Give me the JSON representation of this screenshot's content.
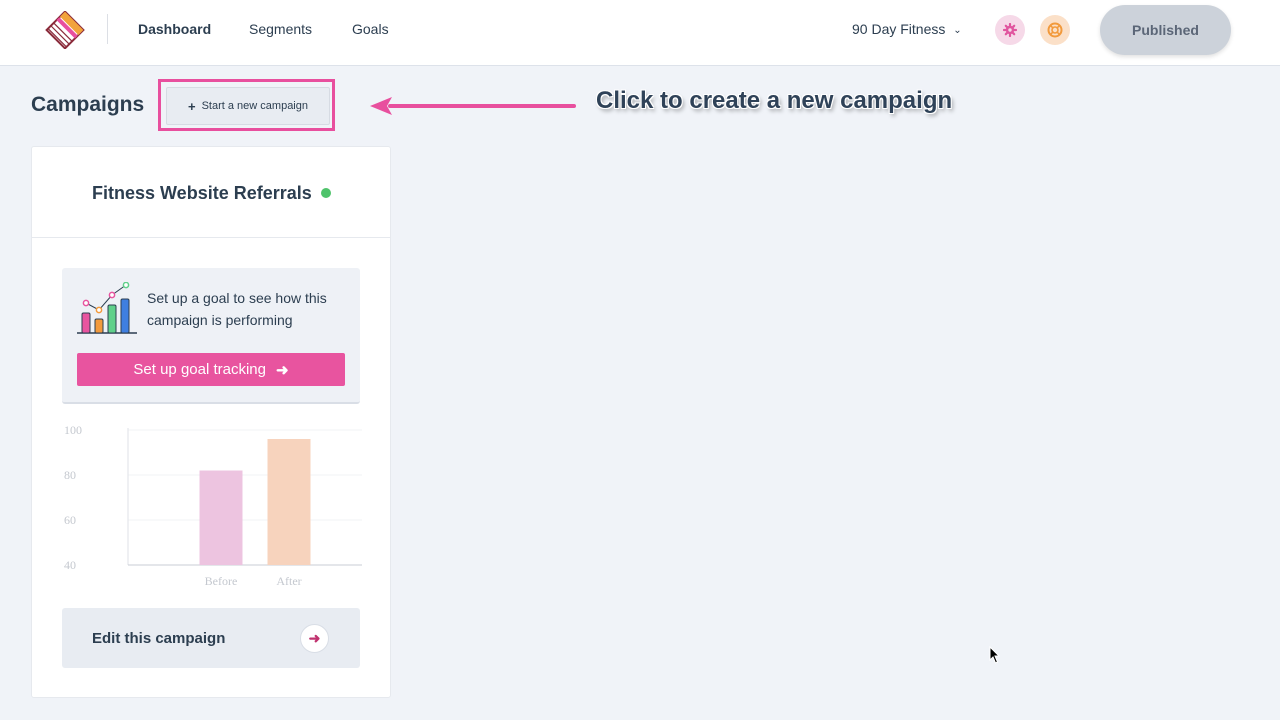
{
  "nav": {
    "dashboard": "Dashboard",
    "segments": "Segments",
    "goals": "Goals",
    "site_name": "90 Day Fitness",
    "publish": "Published",
    "icons": [
      "logo-icon",
      "chevron-down-icon",
      "gear-icon",
      "lifebuoy-icon"
    ]
  },
  "page": {
    "title": "Campaigns",
    "new_campaign_label": "Start a new campaign",
    "callout": "Click to create a new campaign"
  },
  "campaign": {
    "title": "Fitness Website Referrals",
    "status_color": "#4fc36b",
    "goal_prompt": "Set up a goal to see how this campaign is performing",
    "goal_button": "Set up goal tracking",
    "edit_label": "Edit this campaign"
  },
  "colors": {
    "accent": "#e8549f",
    "highlight": "#e84f9e",
    "publish_bg": "#ccd2da"
  },
  "chart_data": {
    "type": "bar",
    "categories": [
      "Before",
      "After"
    ],
    "values": [
      82,
      96
    ],
    "ylim": [
      40,
      100
    ],
    "yticks": [
      40,
      60,
      80,
      100
    ],
    "colors": [
      "#edc4e0",
      "#f7d3bd"
    ],
    "grid": true
  }
}
